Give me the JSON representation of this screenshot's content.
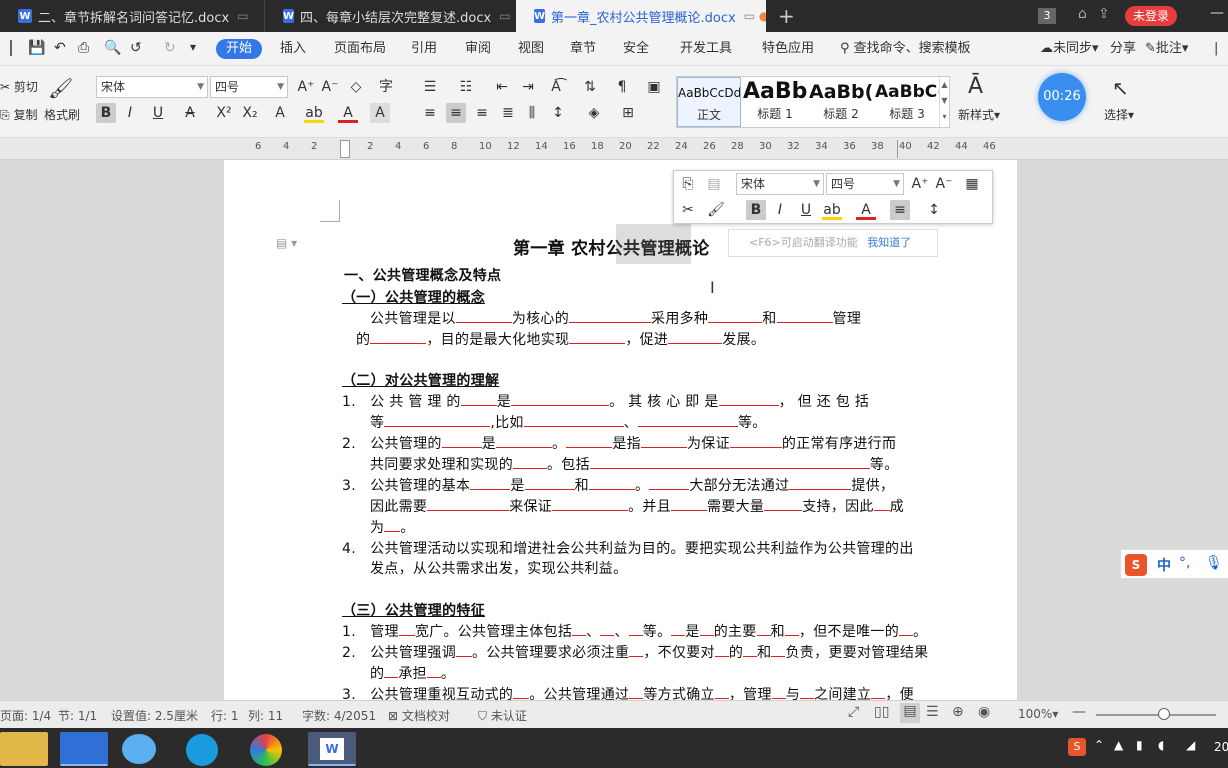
{
  "tabs": [
    {
      "label": "二、章节拆解名词问答记忆.docx",
      "active": false
    },
    {
      "label": "四、每章小结层次完整复述.docx",
      "active": false
    },
    {
      "label": "第一章_农村公共管理概论.docx",
      "active": true
    }
  ],
  "window": {
    "page_count_badge": "3",
    "login_label": "未登录"
  },
  "menu": {
    "items": [
      "开始",
      "插入",
      "页面布局",
      "引用",
      "审阅",
      "视图",
      "章节",
      "安全",
      "开发工具",
      "特色应用"
    ],
    "search": "查找命令、搜索模板",
    "sync": "未同步",
    "share": "分享",
    "comment": "批注"
  },
  "ribbon": {
    "cut": "剪切",
    "copy": "复制",
    "format_painter": "格式刷",
    "font_name": "宋体",
    "font_size": "四号",
    "styles": [
      {
        "preview": "AaBbCcDd",
        "name": "正文"
      },
      {
        "preview": "AaBb",
        "name": "标题 1"
      },
      {
        "preview": "AaBb(",
        "name": "标题 2"
      },
      {
        "preview": "AaBbC(",
        "name": "标题 3"
      }
    ],
    "new_style": "新样式",
    "select": "选择",
    "timer": "00:26"
  },
  "ruler_numbers": [
    "6",
    "4",
    "2",
    "",
    "2",
    "4",
    "6",
    "8",
    "10",
    "12",
    "14",
    "16",
    "18",
    "20",
    "22",
    "24",
    "26",
    "28",
    "30",
    "32",
    "34",
    "36",
    "38",
    "40",
    "42",
    "44",
    "46"
  ],
  "floatbar": {
    "font_name": "宋体",
    "font_size": "四号"
  },
  "translate_tip": {
    "text": "<F6>可启动翻译功能",
    "action": "我知道了"
  },
  "doc": {
    "title": "第一章 农村公共管理概论",
    "h1": "一、公共管理概念及特点",
    "s1": "（一）公共管理的概念",
    "p1a": [
      "公共管理是以",
      "为核心的",
      "采用多种",
      "和",
      "管理"
    ],
    "p1b": [
      "的",
      "，目的是最大化地实现",
      "，促进",
      "发展。"
    ],
    "s2": "（二）对公共管理的理解",
    "l1a": [
      "1.",
      "公 共 管 理 的",
      "是",
      "。 其 核 心 即 是",
      "， 但 还 包 括"
    ],
    "l1b": [
      "等",
      ",比如",
      "、",
      "等。"
    ],
    "l2a": [
      "2.",
      "公共管理的",
      "是",
      "。",
      "是指",
      "为保证",
      "的正常有序进行而"
    ],
    "l2b": [
      "共同要求处理和实现的",
      "。包括",
      "等。"
    ],
    "l3a": [
      "3.",
      "公共管理的基本",
      "是",
      "和",
      "。",
      "大部分无法通过",
      "提供，"
    ],
    "l3b": [
      "因此需要",
      "来保证",
      "。并且",
      "需要大量",
      "支持，因此",
      "成"
    ],
    "l3c": [
      "为",
      "。"
    ],
    "l4a": [
      "4.",
      "公共管理活动以实现和增进社会公共利益为目的。要把实现公共利益作为公共管理的出"
    ],
    "l4b": [
      "发点，从公共需求出发，实现公共利益。"
    ],
    "s3": "（三）公共管理的特征",
    "m1": [
      "1.",
      "管理",
      "宽广。公共管理主体包括",
      "、",
      "、",
      "等。",
      "是",
      "的主要",
      "和",
      "，但不是唯一的",
      "。"
    ],
    "m2a": [
      "2.",
      "公共管理强调",
      "。公共管理要求必须注重",
      "，不仅要对",
      "的",
      "和",
      "负责，更要对管理结果"
    ],
    "m2b": [
      "的",
      "承担",
      "。"
    ],
    "m3": [
      "3.",
      "公共管理重视互动式的",
      "。公共管理通过",
      "等方式确立",
      "，管理",
      "与",
      "之间建立",
      "，便"
    ]
  },
  "ime": {
    "label": "中"
  },
  "status": {
    "page": "页面: 1/4",
    "section": "节: 1/1",
    "setting": "设置值: 2.5厘米",
    "row": "行: 1",
    "col": "列: 11",
    "words": "字数: 4/2051",
    "proof": "文档校对",
    "cert": "未认证",
    "zoom": "100%"
  },
  "taskbar": {
    "clock": "20"
  }
}
